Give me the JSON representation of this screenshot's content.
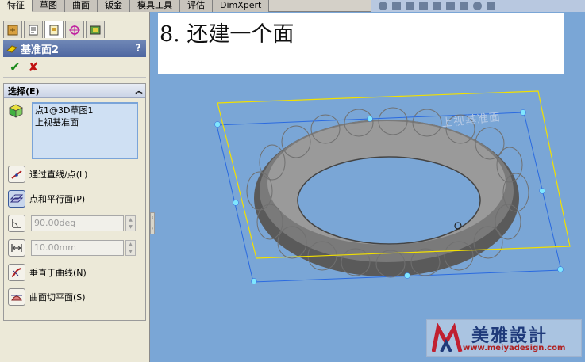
{
  "top_tabs": [
    "特征",
    "草图",
    "曲面",
    "钣金",
    "模具工具",
    "评估",
    "DimXpert"
  ],
  "property_manager": {
    "title": "基准面2",
    "help": "?",
    "ok": "✔",
    "cancel": "✘"
  },
  "selection": {
    "heading": "选择(E)",
    "collapse": "︽",
    "items": [
      "点1@3D草图1",
      "上视基准面"
    ]
  },
  "options": {
    "through_line_point": "通过直线/点(L)",
    "point_parallel": "点和平行面(P)",
    "angle_value": "90.00deg",
    "distance_value": "10.00mm",
    "normal_to_curve": "垂直于曲线(N)",
    "tangent_surface": "曲面切平面(S)"
  },
  "caption": "8. 还建一个面",
  "viewport": {
    "plane_label": "上视基准面"
  },
  "watermark": {
    "name": "美雅設計",
    "url": "www.meiyadesign.com"
  },
  "colors": {
    "viewport_bg": "#7aa6d6",
    "plane_edge": "#f2e000",
    "preview_handle": "#7fe6ff",
    "torus": "#555555",
    "accent_ok": "#1a8a1a",
    "accent_cancel": "#c01010"
  }
}
